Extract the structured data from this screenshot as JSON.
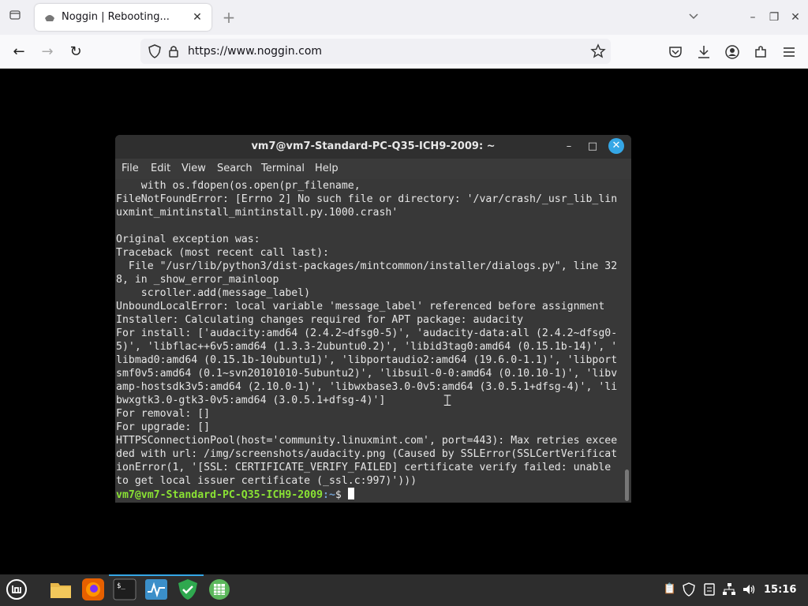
{
  "browser": {
    "tab_title": "Noggin | Rebooting...",
    "url": "https://www.noggin.com",
    "icons": [
      "tab-list-icon",
      "favicon",
      "close-icon",
      "plus-icon",
      "chevron-down-icon",
      "minimize-icon",
      "restore-icon",
      "close-icon",
      "back-icon",
      "forward-icon",
      "reload-icon",
      "shield-icon",
      "lock-icon",
      "star-icon",
      "pocket-icon",
      "download-icon",
      "account-icon",
      "extensions-icon",
      "menu-icon"
    ]
  },
  "terminal": {
    "title": "vm7@vm7-Standard-PC-Q35-ICH9-2009: ~",
    "menu": [
      "File",
      "Edit",
      "View",
      "Search",
      "Terminal",
      "Help"
    ],
    "lines": [
      "    with os.fdopen(os.open(pr_filename,",
      "FileNotFoundError: [Errno 2] No such file or directory: '/var/crash/_usr_lib_lin",
      "uxmint_mintinstall_mintinstall.py.1000.crash'",
      "",
      "Original exception was:",
      "Traceback (most recent call last):",
      "  File \"/usr/lib/python3/dist-packages/mintcommon/installer/dialogs.py\", line 32",
      "8, in _show_error_mainloop",
      "    scroller.add(message_label)",
      "UnboundLocalError: local variable 'message_label' referenced before assignment",
      "Installer: Calculating changes required for APT package: audacity",
      "For install: ['audacity:amd64 (2.4.2~dfsg0-5)', 'audacity-data:all (2.4.2~dfsg0-",
      "5)', 'libflac++6v5:amd64 (1.3.3-2ubuntu0.2)', 'libid3tag0:amd64 (0.15.1b-14)', '",
      "libmad0:amd64 (0.15.1b-10ubuntu1)', 'libportaudio2:amd64 (19.6.0-1.1)', 'libport",
      "smf0v5:amd64 (0.1~svn20101010-5ubuntu2)', 'libsuil-0-0:amd64 (0.10.10-1)', 'libv",
      "amp-hostsdk3v5:amd64 (2.10.0-1)', 'libwxbase3.0-0v5:amd64 (3.0.5.1+dfsg-4)', 'li",
      "bwxgtk3.0-gtk3-0v5:amd64 (3.0.5.1+dfsg-4)']",
      "For removal: []",
      "For upgrade: []",
      "HTTPSConnectionPool(host='community.linuxmint.com', port=443): Max retries excee",
      "ded with url: /img/screenshots/audacity.png (Caused by SSLError(SSLCertVerificat",
      "ionError(1, '[SSL: CERTIFICATE_VERIFY_FAILED] certificate verify failed: unable",
      "to get local issuer certificate (_ssl.c:997)')))"
    ],
    "prompt_user": "vm7@vm7-Standard-PC-Q35-ICH9-2009",
    "prompt_path": ":~",
    "prompt_symbol": "$ "
  },
  "taskbar": {
    "clock": "15:16",
    "apps": [
      "mint-menu-icon",
      "folder-icon",
      "firefox-icon",
      "terminal-icon",
      "system-monitor-icon",
      "shield-app-icon",
      "spreadsheet-icon"
    ]
  },
  "colors": {
    "terminal_bg": "#383838",
    "prompt_user": "#8ae234",
    "accent": "#35a7e6"
  }
}
